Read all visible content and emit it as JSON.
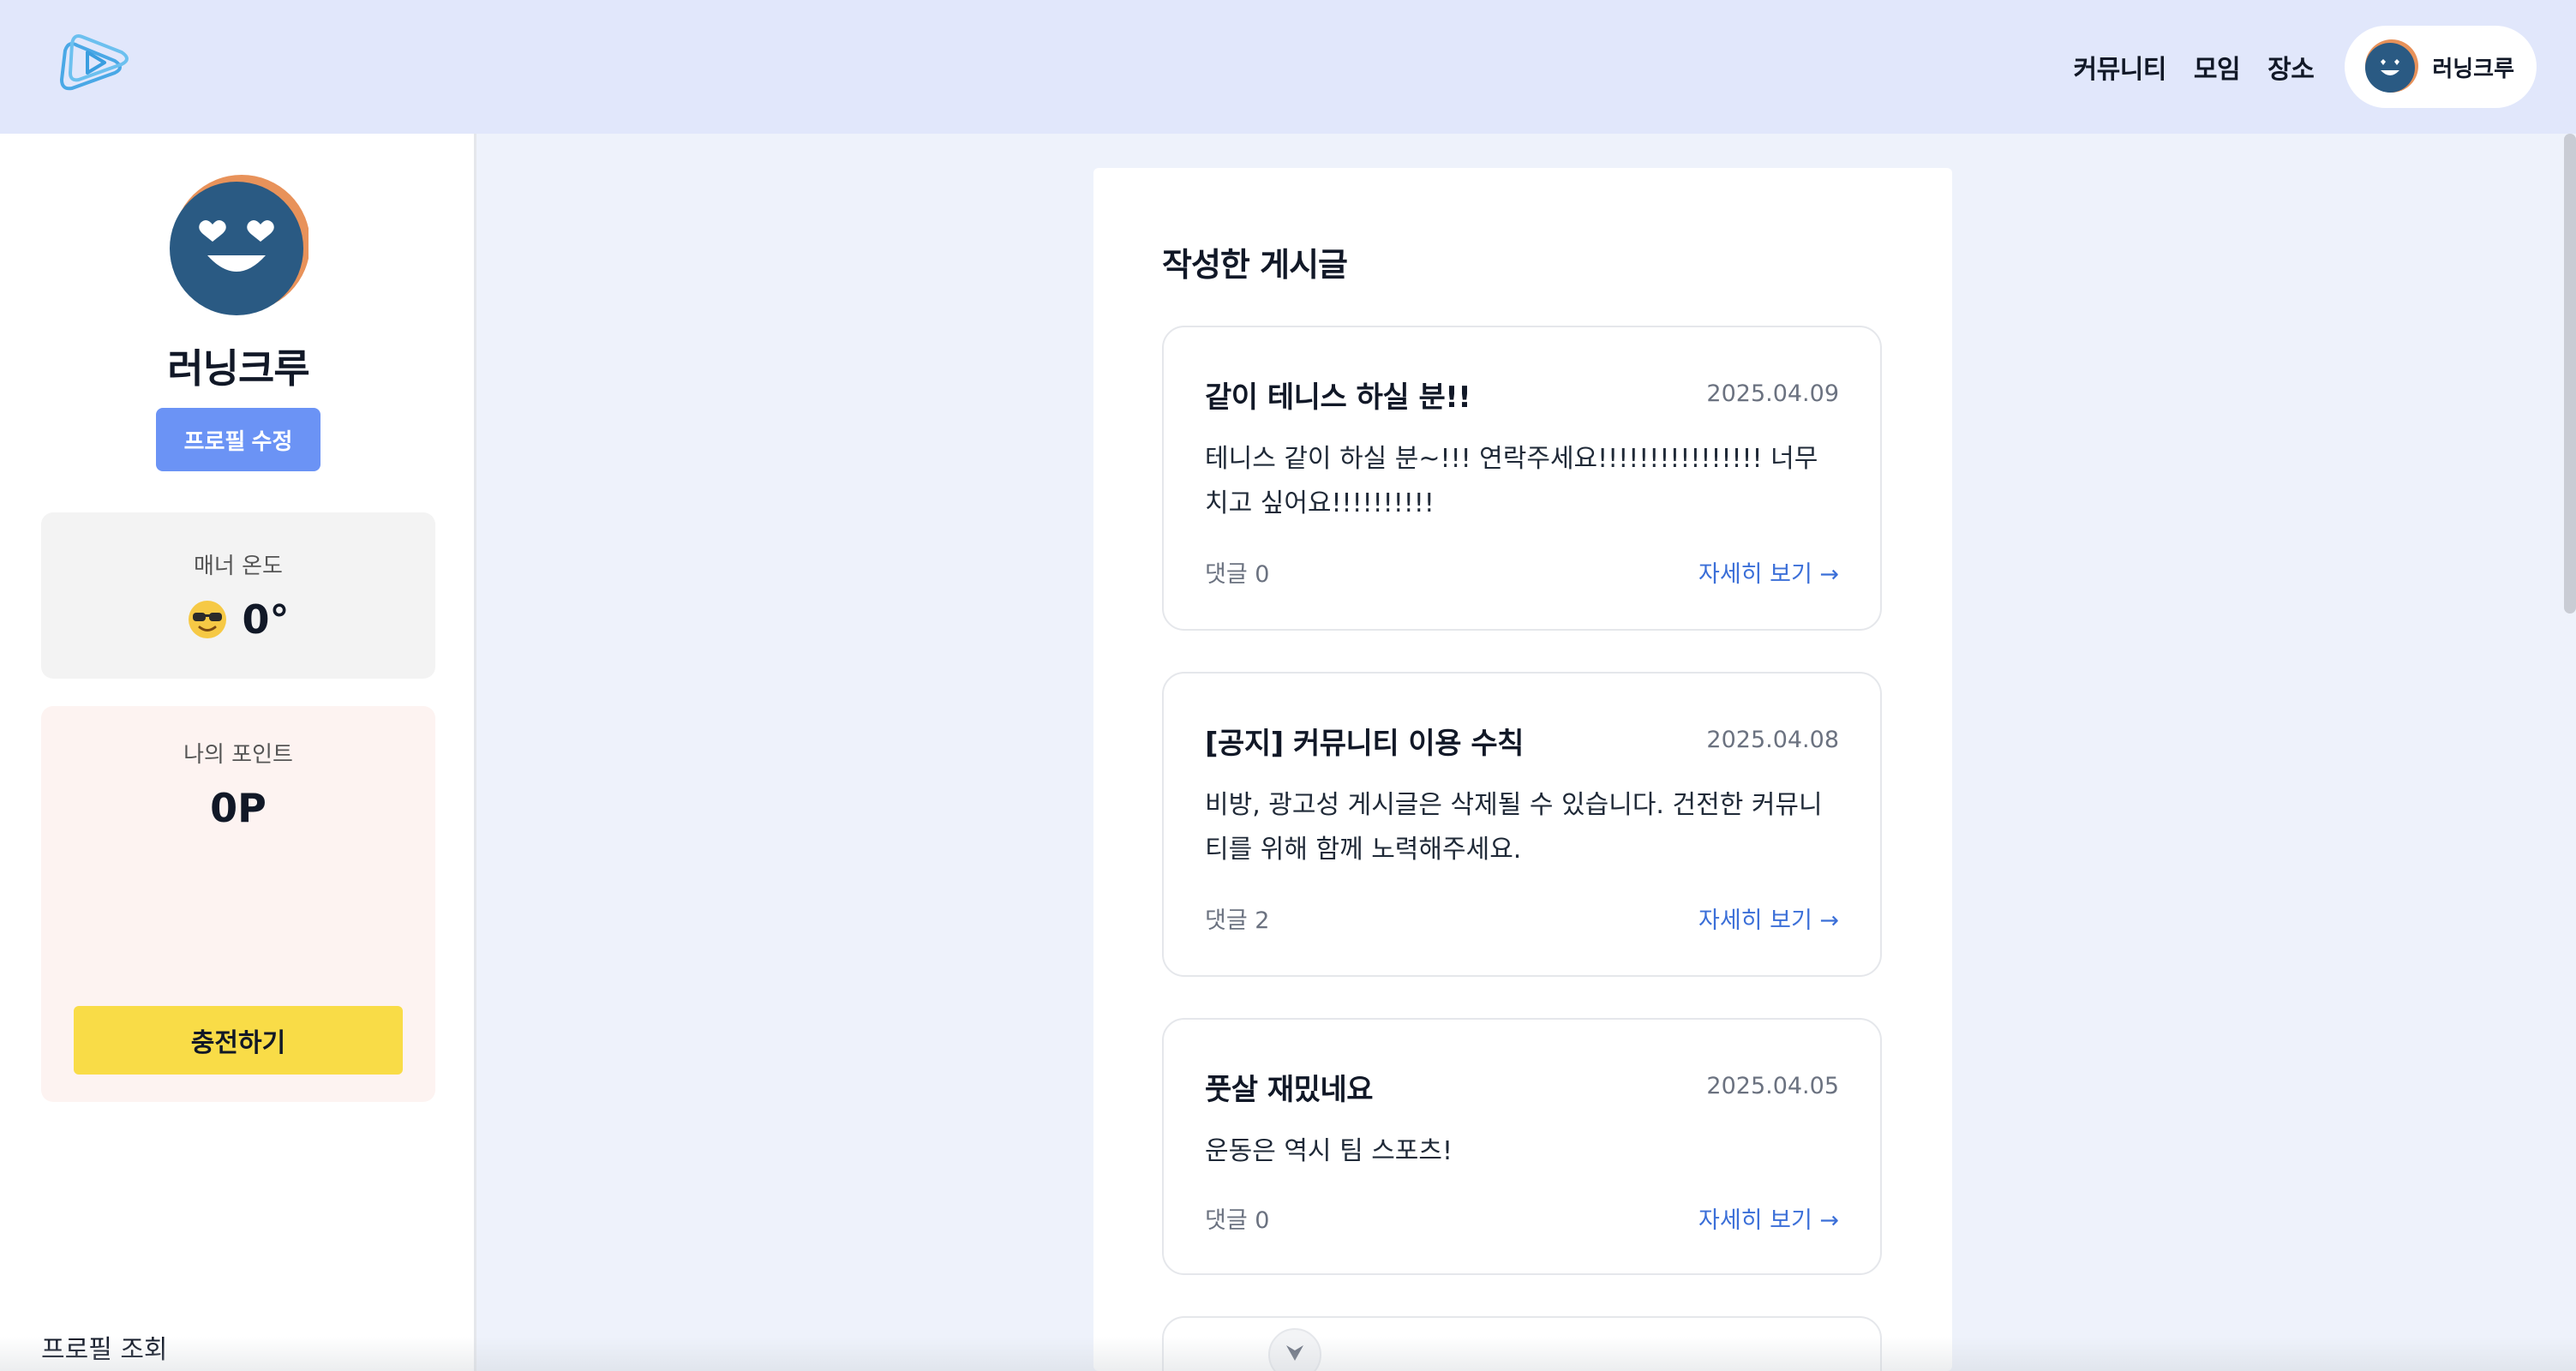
{
  "header": {
    "logo_icon": "play-logo-icon",
    "nav": [
      {
        "label": "커뮤니티"
      },
      {
        "label": "모임"
      },
      {
        "label": "장소"
      }
    ],
    "user": {
      "name": "러닝크루",
      "avatar_icon": "smiley-avatar-icon"
    }
  },
  "sidebar": {
    "profile_name": "러닝크루",
    "edit_button": "프로필 수정",
    "manner": {
      "label": "매너 온도",
      "value": "0°",
      "emoji_icon": "sunglasses-face-icon"
    },
    "points": {
      "label": "나의 포인트",
      "value": "0P",
      "charge_button": "충전하기"
    },
    "footer_label": "프로필 조회"
  },
  "main": {
    "title": "작성한 게시글",
    "posts": [
      {
        "title": "같이 테니스 하실 분!!",
        "date": "2025.04.09",
        "body": "테니스 같이 하실 분~!!! 연락주세요!!!!!!!!!!!!!!!! 너무 치고 싶어요!!!!!!!!!!",
        "comments": "댓글 0",
        "more": "자세히 보기 →"
      },
      {
        "title": "[공지] 커뮤니티 이용 수칙",
        "date": "2025.04.08",
        "body": "비방, 광고성 게시글은 삭제될 수 있습니다. 건전한 커뮤니티를 위해 함께 노력해주세요.",
        "comments": "댓글 2",
        "more": "자세히 보기 →"
      },
      {
        "title": "풋살 재밌네요",
        "date": "2025.04.05",
        "body": "운동은 역시 팀 스포츠!",
        "comments": "댓글 0",
        "more": "자세히 보기 →"
      }
    ]
  },
  "colors": {
    "header_bg": "#e1e7fb",
    "page_bg": "#eef2fb",
    "accent_blue": "#6b93f5",
    "link_blue": "#3b6fd8",
    "charge_yellow": "#f9dc47",
    "avatar_navy": "#2a5a83",
    "avatar_ring": "#e8925a"
  }
}
